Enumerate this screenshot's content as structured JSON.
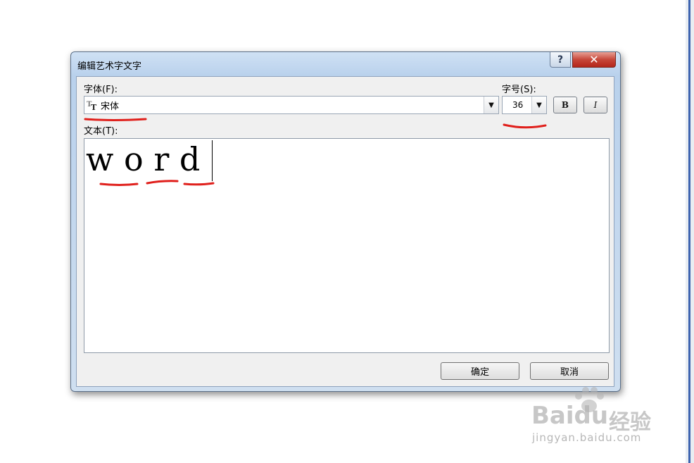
{
  "dialog": {
    "title": "编辑艺术字文字",
    "help_label": "?",
    "close_label": "✕"
  },
  "font": {
    "label": "字体(F):",
    "value": "宋体",
    "dropdown_arrow": "▼"
  },
  "size": {
    "label": "字号(S):",
    "value": "36",
    "dropdown_arrow": "▼"
  },
  "format": {
    "bold_label": "B",
    "italic_label": "I"
  },
  "text": {
    "label": "文本(T):",
    "value": "w o r d"
  },
  "buttons": {
    "ok_label": "确定",
    "cancel_label": "取消"
  },
  "watermark": {
    "logo": "Baidu",
    "brand": "经验",
    "url": "jingyan.baidu.com"
  },
  "colors": {
    "annotation": "#e0201c",
    "titlebar": "#b9d1ec"
  }
}
